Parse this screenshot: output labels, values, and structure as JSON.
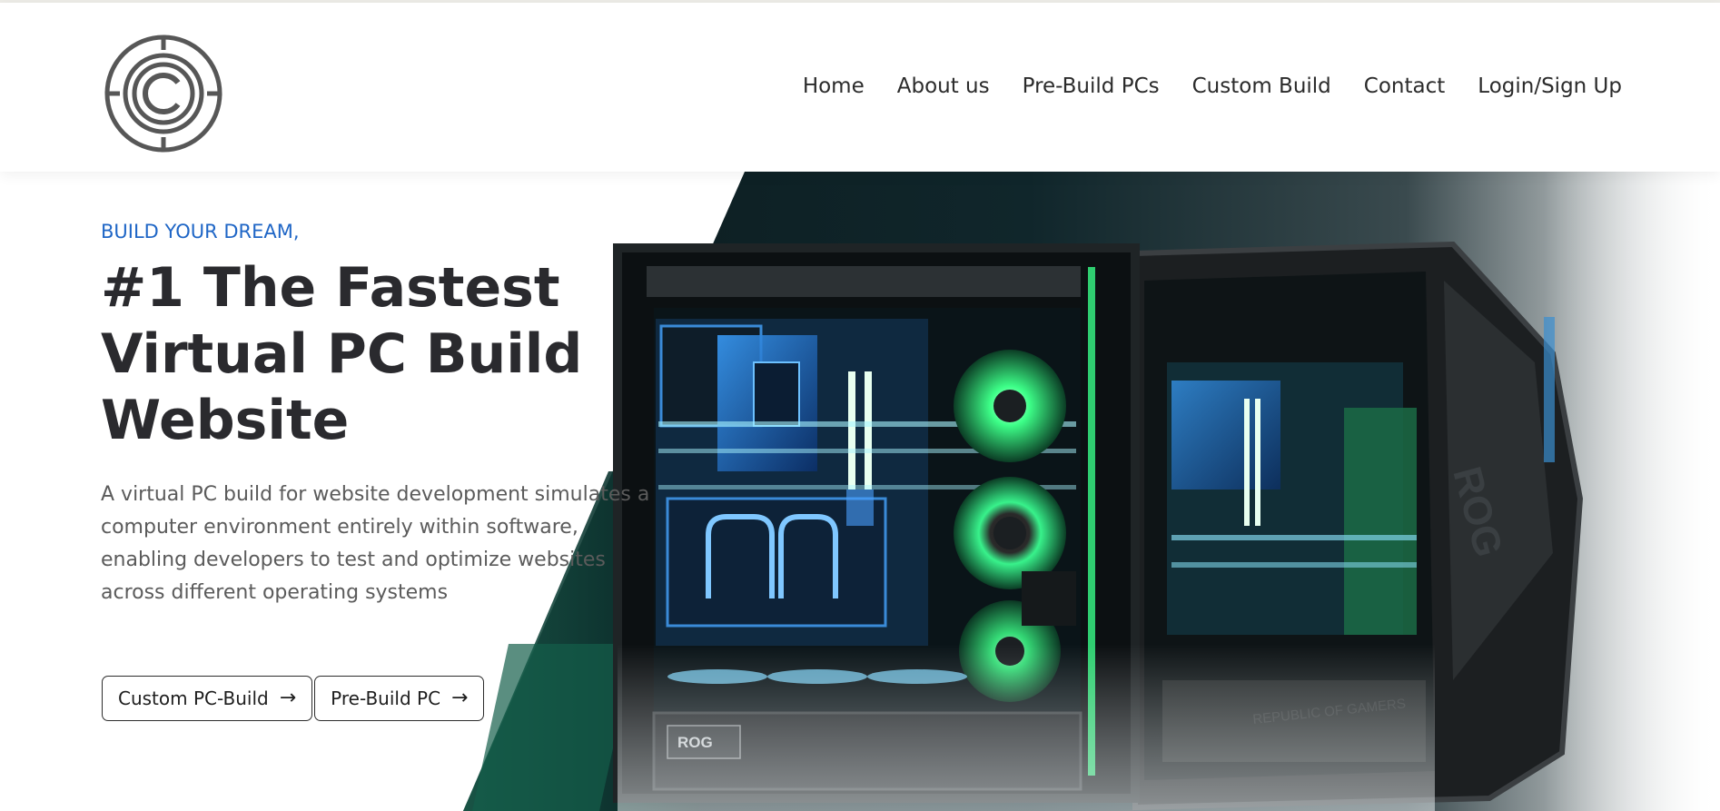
{
  "header": {
    "logo_icon": "c-circle-logo-icon",
    "nav": [
      {
        "label": "Home"
      },
      {
        "label": "About us"
      },
      {
        "label": "Pre-Build PCs"
      },
      {
        "label": "Custom Build"
      },
      {
        "label": "Contact"
      },
      {
        "label": "Login/Sign Up"
      }
    ]
  },
  "hero": {
    "eyebrow": "BUILD YOUR DREAM,",
    "title": "#1 The Fastest Virtual PC Build Website",
    "description": "A virtual PC build for website development simulates a computer environment entirely within software, enabling developers to test and optimize websites across different operating systems",
    "buttons": [
      {
        "label": "Custom PC-Build",
        "icon": "arrow-right-icon"
      },
      {
        "label": "Pre-Build PC",
        "icon": "arrow-right-icon"
      }
    ],
    "image": {
      "description": "Two gaming PC cases with liquid cooling and green/blue RGB lighting",
      "case_labels": [
        "ROG",
        "REPUBLIC OF GAMERS"
      ]
    },
    "colors": {
      "eyebrow": "#1f66c6",
      "title": "#2a2a2e",
      "body_text": "#5b5b5b",
      "accent_green": "#29d96a",
      "accent_blue": "#2b8cff"
    }
  }
}
